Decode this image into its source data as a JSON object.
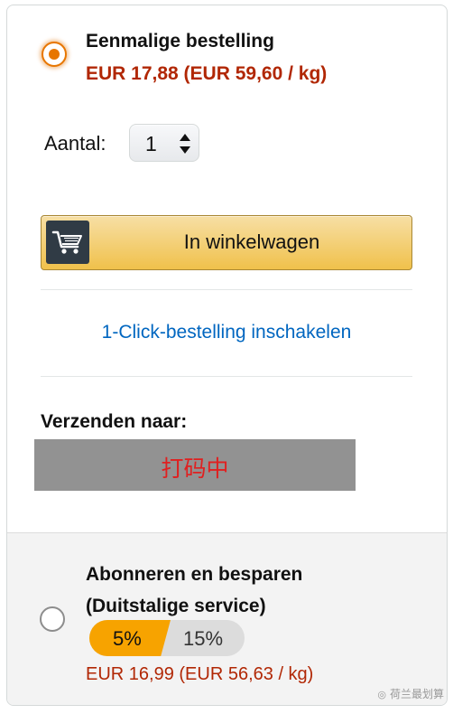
{
  "one_time": {
    "title": "Eenmalige bestelling",
    "price": "EUR 17,88 (EUR 59,60 / kg)"
  },
  "quantity": {
    "label": "Aantal:",
    "value": "1"
  },
  "add_to_cart": {
    "label": "In winkelwagen",
    "icon": "cart-icon"
  },
  "one_click": {
    "label": "1-Click-bestelling inschakelen"
  },
  "shipping": {
    "label": "Verzenden naar:",
    "redacted_text": "打码中"
  },
  "subscribe": {
    "title_line1": "Abonneren en besparen",
    "title_line2": "(Duitstalige service)",
    "discount_selected": "5%",
    "discount_other": "15%",
    "price": "EUR 16,99 (EUR 56,63 / kg)"
  },
  "watermark": {
    "text": "荷兰最划算"
  },
  "colors": {
    "accent_orange": "#e77600",
    "price_red": "#b12704",
    "link_blue": "#0066c0",
    "button_yellow": "#f0c14b",
    "discount_orange": "#f7a300"
  }
}
